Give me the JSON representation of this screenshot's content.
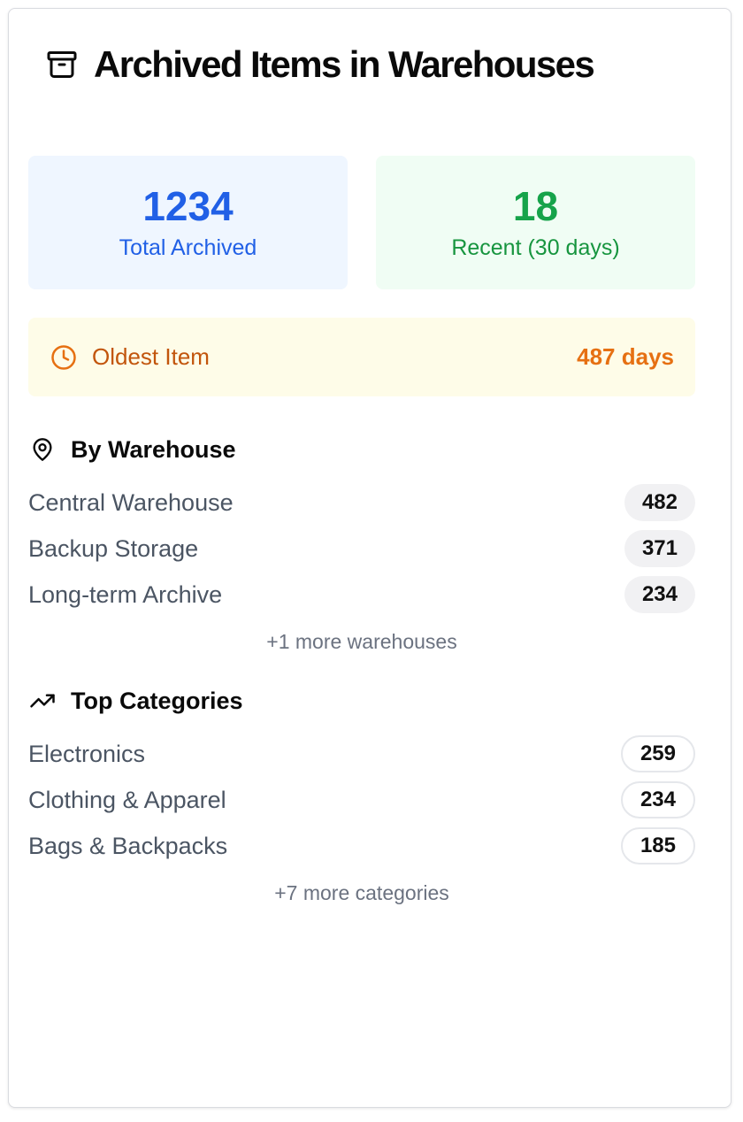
{
  "header": {
    "title": "Archived Items in Warehouses",
    "icon": "archive-icon"
  },
  "stats": {
    "total": {
      "value": "1234",
      "label": "Total Archived",
      "color": "#2160e6"
    },
    "recent": {
      "value": "18",
      "label": "Recent (30 days)",
      "color": "#16a34a"
    }
  },
  "oldest": {
    "label": "Oldest Item",
    "value": "487 days",
    "icon": "clock-icon"
  },
  "warehouses": {
    "title": "By Warehouse",
    "icon": "map-pin-icon",
    "items": [
      {
        "name": "Central Warehouse",
        "count": "482"
      },
      {
        "name": "Backup Storage",
        "count": "371"
      },
      {
        "name": "Long-term Archive",
        "count": "234"
      }
    ],
    "more": "+1 more warehouses"
  },
  "categories": {
    "title": "Top Categories",
    "icon": "trending-up-icon",
    "items": [
      {
        "name": "Electronics",
        "count": "259"
      },
      {
        "name": "Clothing & Apparel",
        "count": "234"
      },
      {
        "name": "Bags & Backpacks",
        "count": "185"
      }
    ],
    "more": "+7 more categories"
  }
}
